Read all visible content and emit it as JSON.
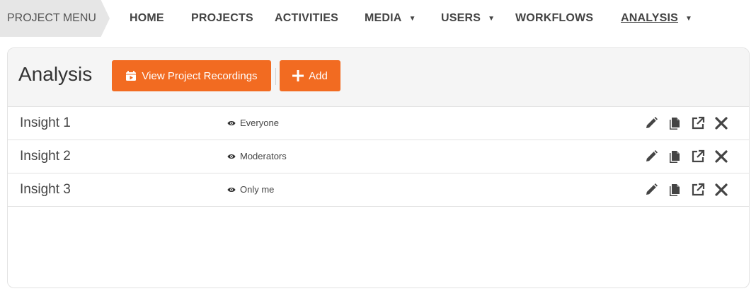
{
  "nav": {
    "project_menu": "PROJECT MENU",
    "items": [
      {
        "label": "HOME",
        "caret": false
      },
      {
        "label": "PROJECTS",
        "caret": false
      },
      {
        "label": "ACTIVITIES",
        "caret": false
      },
      {
        "label": "MEDIA",
        "caret": true
      },
      {
        "label": "USERS",
        "caret": true
      },
      {
        "label": "WORKFLOWS",
        "caret": false
      },
      {
        "label": "ANALYSIS",
        "caret": true,
        "active": true
      }
    ]
  },
  "panel": {
    "title": "Analysis",
    "view_recordings_label": "View Project Recordings",
    "add_label": "Add"
  },
  "insights": [
    {
      "name": "Insight 1",
      "visibility": "Everyone"
    },
    {
      "name": "Insight 2",
      "visibility": "Moderators"
    },
    {
      "name": "Insight 3",
      "visibility": "Only me"
    }
  ],
  "colors": {
    "accent": "#f26b21",
    "icon": "#444444"
  },
  "icons": {
    "row_actions": [
      "pencil-icon",
      "copy-icon",
      "external-link-icon",
      "close-icon"
    ],
    "visibility": "eye-icon",
    "recordings": "video-calendar-icon",
    "add": "plus-icon"
  }
}
